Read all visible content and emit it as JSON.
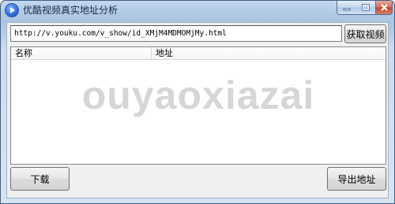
{
  "window": {
    "title": "优酷视频真实地址分析",
    "icon": "play-icon"
  },
  "toolbar": {
    "url_value": "http://v.youku.com/v_show/id_XMjM4MDMOMjMy.html",
    "fetch_label": "获取视频"
  },
  "list": {
    "columns": [
      "名称",
      "地址"
    ],
    "rows": []
  },
  "watermark": "ouyaoxiazai",
  "footer": {
    "download_label": "下载",
    "export_label": "导出地址"
  },
  "colors": {
    "close_button": "#c3462d",
    "titlebar": "#b3cbe6"
  }
}
